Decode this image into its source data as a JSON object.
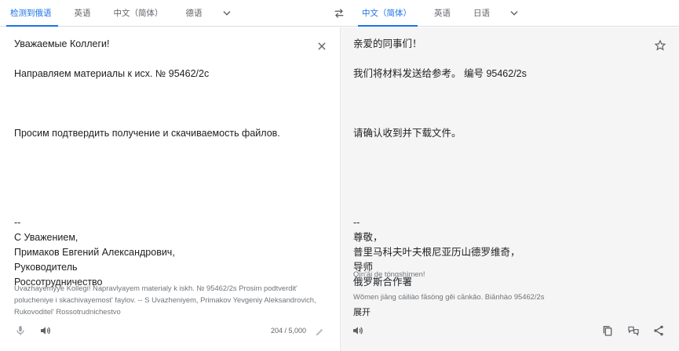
{
  "source_tabs": [
    "检测到俄语",
    "英语",
    "中文（简体）",
    "德语"
  ],
  "target_tabs": [
    "中文（简体）",
    "英语",
    "日语"
  ],
  "source": {
    "lines": [
      "Уважаемые Коллеги!",
      "",
      "Направляем материалы к исх. № 95462/2с",
      "",
      "",
      "",
      "Просим подтвердить получение и скачиваемость файлов.",
      "",
      "",
      "",
      "",
      "",
      "--",
      "С Уважением,",
      "Примаков Евгений Александрович,",
      "Руководитель",
      "Россотрудничество"
    ],
    "transliteration": "Uvazhayemyye Kollegi! Napravlyayem materialy k iskh. № 95462/2s Prosim podtverdit' polucheniye i skachivayemost' faylov. -- S Uvazheniyem, Primakov Yevgeniy Aleksandrovich, Rukovoditel' Rossotrudnichestvo",
    "char_count": "204 / 5,000"
  },
  "target": {
    "lines": [
      "亲爱的同事们！",
      "",
      "我们将材料发送给参考。 编号 95462/2s",
      "",
      "",
      "",
      "请确认收到并下载文件。",
      "",
      "",
      "",
      "",
      "",
      "--",
      "尊敬，",
      "普里马科夫叶夫根尼亚历山德罗维奇，",
      "导师",
      "俄罗斯合作署"
    ],
    "pinyin_1": "Qīn'ài de tóngshìmen!",
    "pinyin_2": "Wǒmen jiāng cáiliào fāsòng gěi cānkǎo. Biānhào 95462/2s",
    "expand_label": "展开"
  },
  "colors": {
    "accent": "#1a73e8",
    "icon": "#5f6368",
    "target_bg": "#f5f5f5"
  }
}
